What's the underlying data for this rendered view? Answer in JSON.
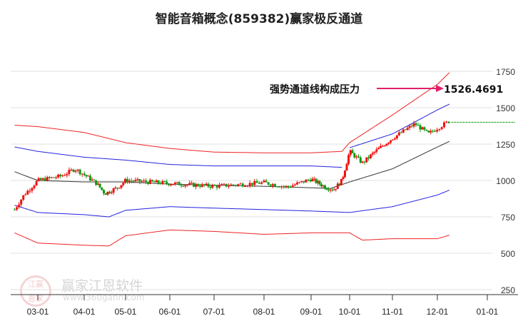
{
  "chart_data": {
    "type": "candlestick",
    "title": "智能音箱概念(859382)赢家极反通道",
    "y_ticks": [
      1750,
      1500,
      1250,
      1000,
      750,
      500,
      250
    ],
    "x_ticks": [
      "03-01",
      "04-01",
      "05-01",
      "06-01",
      "07-01",
      "08-01",
      "09-01",
      "10-01",
      "11-01",
      "12-01",
      "01-01"
    ],
    "ylim": [
      250,
      1750
    ],
    "grid": true,
    "annotation": {
      "text": "强势通道线构成压力",
      "value": "1526.4691"
    },
    "last_close_level": 1400,
    "price_anchors": [
      [
        -0.5,
        800
      ],
      [
        -0.3,
        900
      ],
      [
        0,
        1000
      ],
      [
        0.5,
        1030
      ],
      [
        0.8,
        1080
      ],
      [
        1.0,
        1040
      ],
      [
        1.3,
        980
      ],
      [
        1.5,
        910
      ],
      [
        1.8,
        950
      ],
      [
        2,
        1000
      ],
      [
        3,
        980
      ],
      [
        4,
        960
      ],
      [
        5,
        985
      ],
      [
        5.5,
        955
      ],
      [
        6,
        1010
      ],
      [
        6.4,
        950
      ],
      [
        6.6,
        940
      ],
      [
        6.8,
        1000
      ],
      [
        7,
        1200
      ],
      [
        7.3,
        1120
      ],
      [
        7.6,
        1200
      ],
      [
        8,
        1290
      ],
      [
        8.5,
        1390
      ],
      [
        8.8,
        1320
      ],
      [
        9,
        1360
      ],
      [
        9.25,
        1410
      ]
    ],
    "channels": [
      {
        "name": "mid",
        "color": "#333333",
        "anchors": [
          [
            -0.5,
            1060
          ],
          [
            0,
            1000
          ],
          [
            1,
            990
          ],
          [
            2,
            990
          ],
          [
            3,
            975
          ],
          [
            5,
            960
          ],
          [
            6.5,
            945
          ],
          [
            7,
            990
          ],
          [
            8,
            1080
          ],
          [
            9,
            1230
          ],
          [
            9.25,
            1270
          ]
        ]
      },
      {
        "name": "upper-inner",
        "color": "#2222dd",
        "anchors": [
          [
            -0.5,
            1230
          ],
          [
            0,
            1200
          ],
          [
            1,
            1160
          ],
          [
            2,
            1140
          ],
          [
            3,
            1110
          ],
          [
            4,
            1100
          ],
          [
            5,
            1100
          ],
          [
            6,
            1100
          ],
          [
            6.8,
            1090
          ]
        ]
      },
      {
        "name": "strong-channel",
        "color": "#2222dd",
        "anchors": [
          [
            7,
            1225
          ],
          [
            8,
            1320
          ],
          [
            9.25,
            1526
          ]
        ]
      },
      {
        "name": "lower-inner",
        "color": "#2222dd",
        "anchors": [
          [
            -0.5,
            830
          ],
          [
            0,
            780
          ],
          [
            1,
            765
          ],
          [
            1.6,
            750
          ],
          [
            2,
            795
          ],
          [
            3,
            820
          ],
          [
            4,
            810
          ],
          [
            5,
            800
          ],
          [
            6,
            790
          ],
          [
            7,
            780
          ],
          [
            8,
            820
          ],
          [
            9,
            900
          ],
          [
            9.25,
            935
          ]
        ]
      },
      {
        "name": "upper-outer",
        "color": "#ee2222",
        "anchors": [
          [
            -0.5,
            1380
          ],
          [
            0,
            1370
          ],
          [
            1,
            1330
          ],
          [
            2,
            1260
          ],
          [
            3,
            1220
          ],
          [
            4,
            1195
          ],
          [
            5,
            1190
          ],
          [
            6,
            1190
          ],
          [
            6.8,
            1200
          ],
          [
            7,
            1260
          ],
          [
            8,
            1450
          ],
          [
            9,
            1660
          ],
          [
            9.25,
            1745
          ]
        ]
      },
      {
        "name": "lower-outer",
        "color": "#ee2222",
        "anchors": [
          [
            -0.5,
            640
          ],
          [
            0,
            570
          ],
          [
            1,
            555
          ],
          [
            1.6,
            550
          ],
          [
            2,
            620
          ],
          [
            3,
            660
          ],
          [
            4,
            650
          ],
          [
            5,
            630
          ],
          [
            6,
            640
          ],
          [
            7,
            640
          ],
          [
            7.3,
            590
          ],
          [
            8,
            600
          ],
          [
            9,
            600
          ],
          [
            9.25,
            625
          ]
        ]
      }
    ]
  },
  "watermark": {
    "name": "赢家江恩软件",
    "url": "www.360gann.com",
    "seal": "江赢恩家"
  }
}
